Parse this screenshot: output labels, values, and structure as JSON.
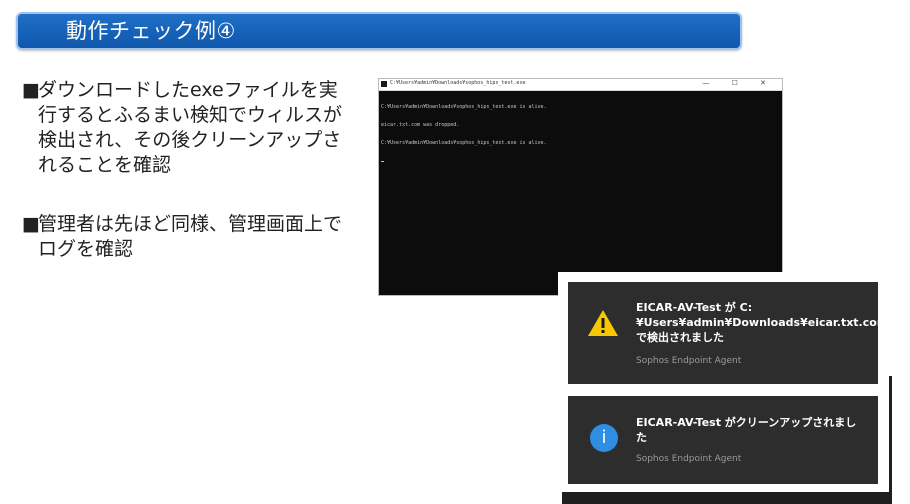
{
  "slide": {
    "title": "動作チェック例④",
    "bullets": [
      {
        "mark": "■",
        "text": "ダウンロードしたexeファイルを実行するとふるまい検知でウィルスが検出され、その後クリーンアップされることを確認"
      },
      {
        "mark": "■",
        "text": "管理者は先ほど同様、管理画面上でログを確認"
      }
    ]
  },
  "console": {
    "window_title": "C:¥Users¥admin¥Downloads¥sophos_hips_test.exe",
    "controls": "—   ☐   ✕",
    "lines": [
      "C:¥Users¥admin¥Downloads¥sophos_hips_test.exe is alive.",
      "eicar.txt.com was dropped.",
      "C:¥Users¥admin¥Downloads¥sophos_hips_test.exe is alive."
    ]
  },
  "notifications": [
    {
      "icon": "warning-icon",
      "message": "EICAR-AV-Test が C:¥Users¥admin¥Downloads¥eicar.txt.com で検出されました",
      "app": "Sophos Endpoint Agent"
    },
    {
      "icon": "info-icon",
      "icon_glyph": "i",
      "message": "EICAR-AV-Test がクリーンアップされました",
      "app": "Sophos Endpoint Agent"
    }
  ],
  "colors": {
    "title_bar": "#0f57ad",
    "toast_bg": "#2d2d2d",
    "warning": "#f7c800",
    "info": "#2f8de4"
  }
}
